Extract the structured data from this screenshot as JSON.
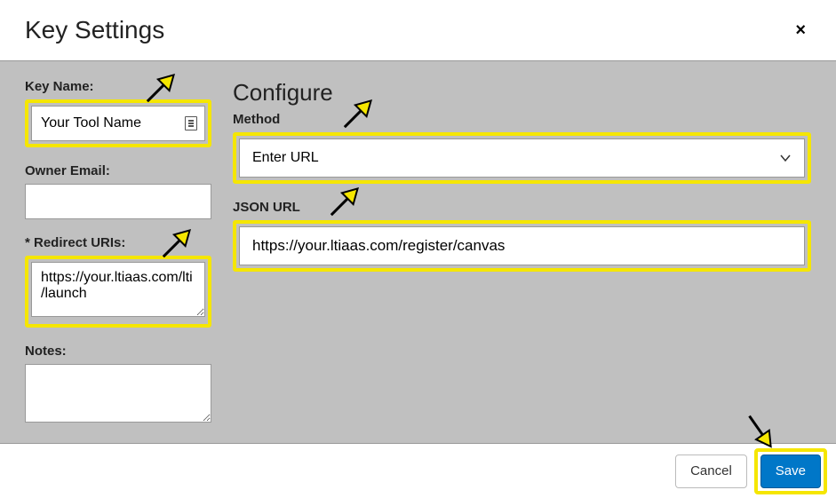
{
  "dialog": {
    "title": "Key Settings"
  },
  "left": {
    "key_name_label": "Key Name:",
    "key_name_value": "Your Tool Name",
    "owner_email_label": "Owner Email:",
    "owner_email_value": "",
    "redirect_uris_label": "* Redirect URIs:",
    "redirect_uris_value": "https://your.ltiaas.com/lti/launch",
    "notes_label": "Notes:",
    "notes_value": ""
  },
  "right": {
    "configure_title": "Configure",
    "method_label": "Method",
    "method_value": "Enter URL",
    "json_url_label": "JSON URL",
    "json_url_value": "https://your.ltiaas.com/register/canvas"
  },
  "footer": {
    "cancel_label": "Cancel",
    "save_label": "Save"
  },
  "colors": {
    "highlight": "#f5e600",
    "primary": "#0077c8",
    "arrow_fill": "#f5e600",
    "arrow_stroke": "#000"
  }
}
